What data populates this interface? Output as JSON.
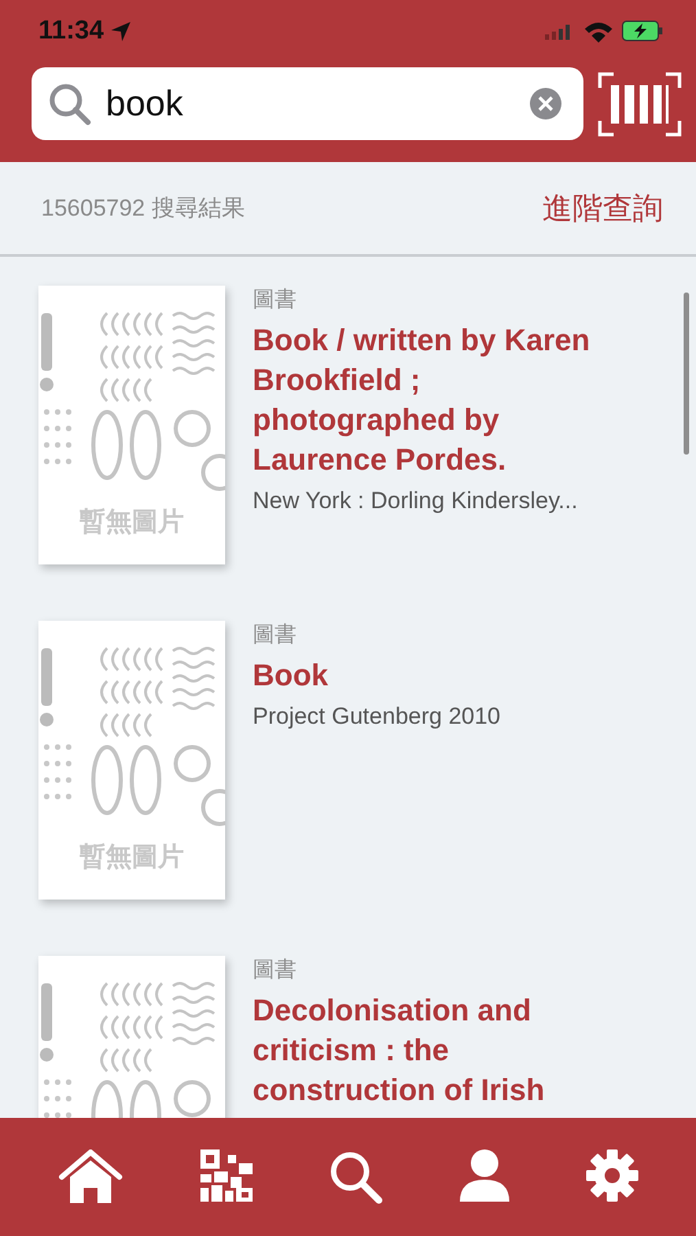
{
  "status_bar": {
    "time": "11:34"
  },
  "search": {
    "value": "book"
  },
  "results_header": {
    "count": "15605792 搜尋結果",
    "advanced_link": "進階查詢"
  },
  "results": [
    {
      "category": "圖書",
      "title": "Book / written by Karen Brookfield ; photographed by Laurence Pordes.",
      "publisher": "New York : Dorling Kindersley...",
      "cover_label": "暫無圖片"
    },
    {
      "category": "圖書",
      "title": "Book",
      "publisher": "Project Gutenberg 2010",
      "cover_label": "暫無圖片"
    },
    {
      "category": "圖書",
      "title": "Decolonisation and criticism : the construction of Irish"
    }
  ],
  "tab_bar": [
    {
      "kind": "home"
    },
    {
      "kind": "qr"
    },
    {
      "kind": "search"
    },
    {
      "kind": "profile"
    },
    {
      "kind": "settings"
    }
  ]
}
